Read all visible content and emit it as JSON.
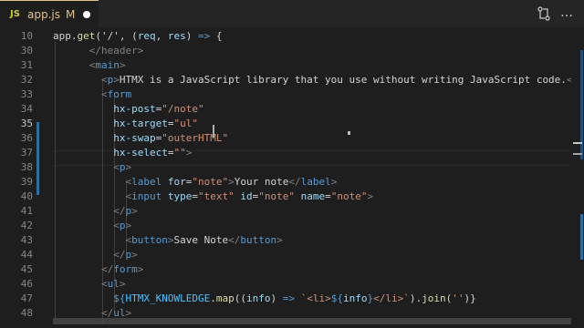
{
  "tab": {
    "icon_label": "JS",
    "filename": "app.js",
    "status": "M"
  },
  "icons": {
    "tab_modified": "unsaved-dot-icon",
    "compare": "compare-changes-icon",
    "more": "more-actions-icon",
    "more_glyph": "…"
  },
  "editor": {
    "active_line": "35",
    "lines": [
      {
        "n": "10",
        "t": [
          [
            "app",
            "txt"
          ],
          [
            ".",
            "txt"
          ],
          [
            "get",
            "fn"
          ],
          [
            "('/', (",
            "txt"
          ],
          [
            "req",
            "attr"
          ],
          [
            ", ",
            "txt"
          ],
          [
            "res",
            "attr"
          ],
          [
            ") ",
            "txt"
          ],
          [
            "=>",
            "kw"
          ],
          [
            " {",
            "txt"
          ]
        ]
      },
      {
        "n": "30",
        "t": [
          [
            "      </header>",
            "tag"
          ]
        ]
      },
      {
        "n": "31",
        "t": [
          [
            "      <",
            "tag"
          ],
          [
            "main",
            "tn"
          ],
          [
            ">",
            "tag"
          ]
        ]
      },
      {
        "n": "32",
        "t": [
          [
            "        <",
            "tag"
          ],
          [
            "p",
            "tn"
          ],
          [
            ">",
            "tag"
          ],
          [
            "HTMX is a JavaScript library that you use without writing JavaScript code.",
            "txt"
          ],
          [
            "</",
            "tag"
          ],
          [
            "p",
            "tn"
          ]
        ]
      },
      {
        "n": "33",
        "t": [
          [
            "        <",
            "tag"
          ],
          [
            "form",
            "tn"
          ]
        ]
      },
      {
        "n": "34",
        "t": [
          [
            "          ",
            "txt"
          ],
          [
            "hx-post",
            "attr"
          ],
          [
            "=",
            "txt"
          ],
          [
            "\"/note\"",
            "str"
          ]
        ]
      },
      {
        "n": "35",
        "t": [
          [
            "          ",
            "txt"
          ],
          [
            "hx-target",
            "attr"
          ],
          [
            "=",
            "txt"
          ],
          [
            "\"ul\"",
            "str"
          ]
        ]
      },
      {
        "n": "36",
        "t": [
          [
            "          ",
            "txt"
          ],
          [
            "hx-swap",
            "attr"
          ],
          [
            "=",
            "txt"
          ],
          [
            "\"outerHTML\"",
            "str"
          ]
        ]
      },
      {
        "n": "37",
        "t": [
          [
            "          ",
            "txt"
          ],
          [
            "hx-select",
            "attr"
          ],
          [
            "=",
            "txt"
          ],
          [
            "\"\"",
            "str"
          ],
          [
            ">",
            "tag"
          ]
        ]
      },
      {
        "n": "38",
        "t": [
          [
            "          <",
            "tag"
          ],
          [
            "p",
            "tn"
          ],
          [
            ">",
            "tag"
          ]
        ]
      },
      {
        "n": "39",
        "t": [
          [
            "            <",
            "tag"
          ],
          [
            "label",
            "tn"
          ],
          [
            " ",
            "txt"
          ],
          [
            "for",
            "attr"
          ],
          [
            "=",
            "txt"
          ],
          [
            "\"note\"",
            "str"
          ],
          [
            ">",
            "tag"
          ],
          [
            "Your note",
            "txt"
          ],
          [
            "</",
            "tag"
          ],
          [
            "label",
            "tn"
          ],
          [
            ">",
            "tag"
          ]
        ]
      },
      {
        "n": "40",
        "t": [
          [
            "            <",
            "tag"
          ],
          [
            "input",
            "tn"
          ],
          [
            " ",
            "txt"
          ],
          [
            "type",
            "attr"
          ],
          [
            "=",
            "txt"
          ],
          [
            "\"text\"",
            "str"
          ],
          [
            " ",
            "txt"
          ],
          [
            "id",
            "attr"
          ],
          [
            "=",
            "txt"
          ],
          [
            "\"note\"",
            "str"
          ],
          [
            " ",
            "txt"
          ],
          [
            "name",
            "attr"
          ],
          [
            "=",
            "txt"
          ],
          [
            "\"note\"",
            "str"
          ],
          [
            ">",
            "tag"
          ]
        ]
      },
      {
        "n": "41",
        "t": [
          [
            "          </",
            "tag"
          ],
          [
            "p",
            "tn"
          ],
          [
            ">",
            "tag"
          ]
        ]
      },
      {
        "n": "42",
        "t": [
          [
            "          <",
            "tag"
          ],
          [
            "p",
            "tn"
          ],
          [
            ">",
            "tag"
          ]
        ]
      },
      {
        "n": "43",
        "t": [
          [
            "            <",
            "tag"
          ],
          [
            "button",
            "tn"
          ],
          [
            ">",
            "tag"
          ],
          [
            "Save Note",
            "txt"
          ],
          [
            "</",
            "tag"
          ],
          [
            "button",
            "tn"
          ],
          [
            ">",
            "tag"
          ]
        ]
      },
      {
        "n": "44",
        "t": [
          [
            "          </",
            "tag"
          ],
          [
            "p",
            "tn"
          ],
          [
            ">",
            "tag"
          ]
        ]
      },
      {
        "n": "45",
        "t": [
          [
            "        </",
            "tag"
          ],
          [
            "form",
            "tn"
          ],
          [
            ">",
            "tag"
          ]
        ]
      },
      {
        "n": "46",
        "t": [
          [
            "        <",
            "tag"
          ],
          [
            "ul",
            "tn"
          ],
          [
            ">",
            "tag"
          ]
        ]
      },
      {
        "n": "47",
        "t": [
          [
            "          ${",
            "kw"
          ],
          [
            "HTMX_KNOWLEDGE",
            "cnst"
          ],
          [
            ".",
            "txt"
          ],
          [
            "map",
            "fn"
          ],
          [
            "((",
            "txt"
          ],
          [
            "info",
            "attr"
          ],
          [
            ") ",
            "txt"
          ],
          [
            "=>",
            "kw"
          ],
          [
            " `",
            "str"
          ],
          [
            "<li>",
            "str"
          ],
          [
            "${",
            "kw"
          ],
          [
            "info",
            "attr"
          ],
          [
            "}",
            "kw"
          ],
          [
            "</li>",
            "str"
          ],
          [
            "`",
            "str"
          ],
          [
            ").",
            "txt"
          ],
          [
            "join",
            "fn"
          ],
          [
            "(",
            "txt"
          ],
          [
            "''",
            "str"
          ],
          [
            ")}",
            "txt"
          ]
        ]
      },
      {
        "n": "48",
        "t": [
          [
            "        </",
            "tag"
          ],
          [
            "ul",
            "tn"
          ],
          [
            ">",
            "tag"
          ]
        ]
      }
    ]
  }
}
